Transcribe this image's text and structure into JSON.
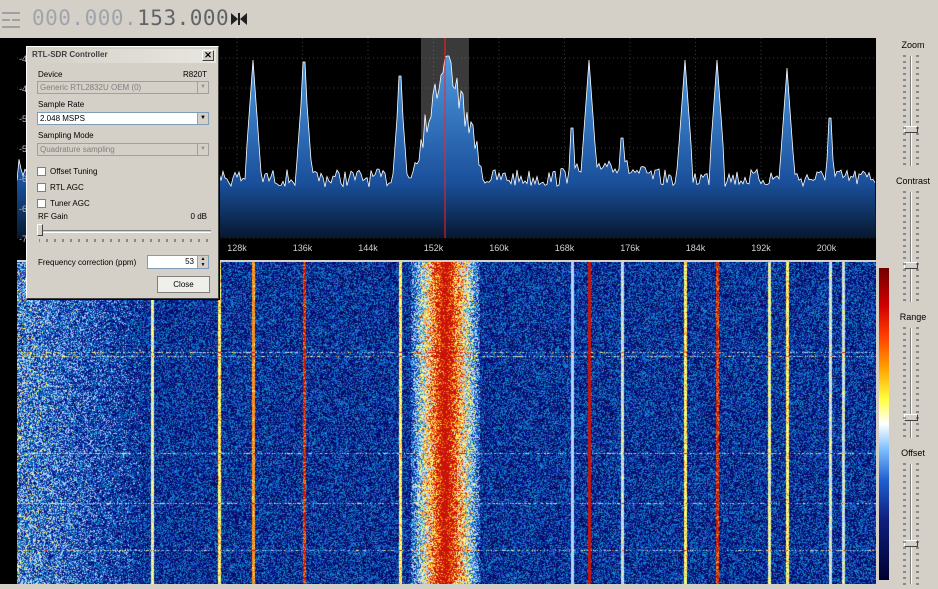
{
  "top_bar": {
    "frequency_dim": "000.000.",
    "frequency_active": "153.000",
    "swap_icon": "bowtie-icon"
  },
  "spectrum": {
    "db_labels": [
      "-40",
      "-45",
      "-50",
      "-55",
      "-60",
      "-65",
      "-70"
    ],
    "freq_ticks": [
      "128k",
      "136k",
      "144k",
      "152k",
      "160k",
      "168k",
      "176k",
      "184k",
      "192k",
      "200k"
    ],
    "center_marker_color": "#ff2020",
    "fill_color": "#1c5ab0"
  },
  "right_panel": {
    "zoom_label": "Zoom",
    "contrast_label": "Contrast",
    "range_label": "Range",
    "offset_label": "Offset"
  },
  "dialog": {
    "title": "RTL-SDR Controller",
    "close_x": "✕",
    "device_label": "Device",
    "tuner_type": "R820T",
    "device_value": "Generic RTL2832U OEM (0)",
    "sample_rate_label": "Sample Rate",
    "sample_rate_value": "2.048 MSPS",
    "sampling_mode_label": "Sampling Mode",
    "sampling_mode_value": "Quadrature sampling",
    "offset_tuning_label": "Offset Tuning",
    "rtl_agc_label": "RTL AGC",
    "tuner_agc_label": "Tuner AGC",
    "rf_gain_label": "RF Gain",
    "rf_gain_value": "0 dB",
    "freq_correction_label": "Frequency correction (ppm)",
    "freq_correction_value": "53",
    "close_button_label": "Close"
  }
}
